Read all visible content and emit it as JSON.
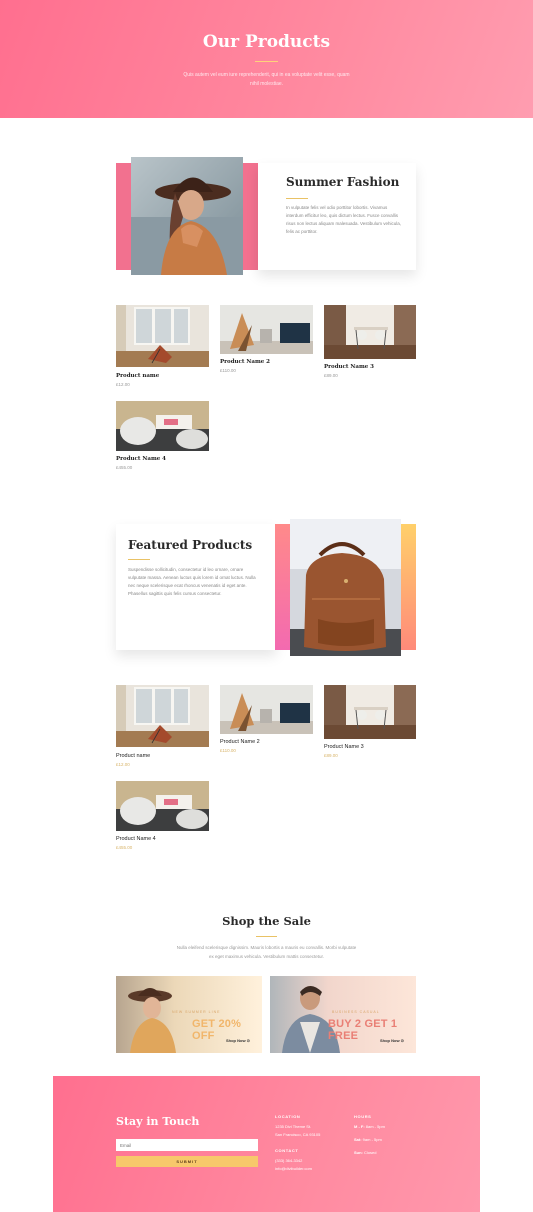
{
  "hero": {
    "title": "Our Products",
    "subtitle": "Quis autem vel eum iure reprehenderit, qui in ea voluptate velit esse, quam nihil molestiae."
  },
  "summer": {
    "title": "Summer Fashion",
    "text": "In vulputate felis vel odio porttitor lobortis. Vivamus interdum efficitur leo, quis dictum lectus. Fusce convallis risus non lectus aliquam malesuada. Vestibulum vehicula, felis ac porttitor."
  },
  "products_a": [
    {
      "name": "Product name",
      "price": "£12.00"
    },
    {
      "name": "Product Name 2",
      "price": "£110.00"
    },
    {
      "name": "Product Name 3",
      "price": "£89.00"
    },
    {
      "name": "Product Name 4",
      "price": "£455.00"
    }
  ],
  "featured": {
    "title": "Featured Products",
    "text": "Suspendisse sollicitudin, consectetur id leo ornare, ornare vulputate massa. Aenean luctus quis lorem id ornat luctus. Nulla nec neque scelerisque ecat rhoncus venenatis id eget ante. Phasellus sagittis quis felis cursus consectetur."
  },
  "products_b": [
    {
      "name": "Product name",
      "price": "£12.00"
    },
    {
      "name": "Product Name 2",
      "price": "£110.00"
    },
    {
      "name": "Product Name 3",
      "price": "£89.00"
    },
    {
      "name": "Product Name 4",
      "price": "£455.00"
    }
  ],
  "sale": {
    "title": "Shop the Sale",
    "text": "Nulla eleifend scelerisque dignissim. Mauris lobortis a mauris eu convallis. Morbi vulputate ex eget maximus vehicula. Vestibulum mattis consectetur.",
    "banners": [
      {
        "small": "NEW SUMMER LINE",
        "big": "GET 20% OFF",
        "cta": "Shop Now ⊙"
      },
      {
        "small": "BUSINESS CASUAL",
        "big": "BUY 2 GET 1 FREE",
        "cta": "Shop Now ⊙"
      }
    ]
  },
  "footer": {
    "title": "Stay in Touch",
    "email_placeholder": "Email",
    "submit_label": "SUBMIT",
    "location_heading": "LOCATION",
    "address_line1": "1235 Divi Theme St.",
    "address_line2": "San Francisco, CA 93105",
    "contact_heading": "CONTACT",
    "phone": "(333) 364-3342",
    "email": "info@divibuilder.com",
    "hours_heading": "HOURS",
    "hours": [
      {
        "day": "M - F:",
        "time": " 8am - 5pm"
      },
      {
        "day": "Sat:",
        "time": " 9am - 5pm"
      },
      {
        "day": "Sun:",
        "time": " Closed"
      }
    ]
  },
  "colors": {
    "accent_pink": "#ff6f8f",
    "accent_gold": "#e9c265"
  }
}
